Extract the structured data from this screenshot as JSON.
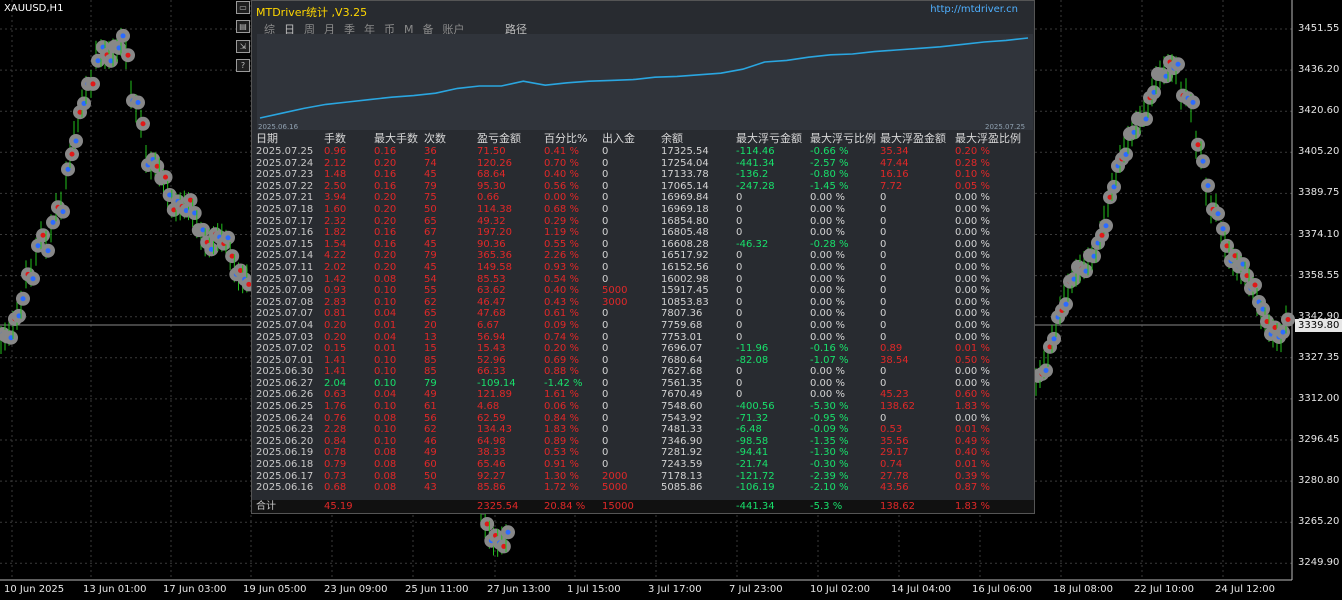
{
  "chart": {
    "symbol": "XAUUSD,H1",
    "current_price": "3339.80",
    "price_labels": [
      "3451.55",
      "3436.20",
      "3420.60",
      "3405.20",
      "3389.75",
      "3374.10",
      "3358.55",
      "3342.90",
      "3327.35",
      "3312.00",
      "3296.45",
      "3280.80",
      "3265.20",
      "3249.90"
    ],
    "time_labels": [
      "10 Jun 2025",
      "13 Jun 01:00",
      "17 Jun 03:00",
      "19 Jun 05:00",
      "23 Jun 09:00",
      "25 Jun 11:00",
      "27 Jun 13:00",
      "1 Jul 15:00",
      "3 Jul 17:00",
      "7 Jul 23:00",
      "10 Jul 02:00",
      "14 Jul 04:00",
      "16 Jul 06:00",
      "18 Jul 08:00",
      "22 Jul 10:00",
      "24 Jul 12:00"
    ]
  },
  "panel": {
    "title": "MTDriver统计 ,V3.25",
    "url": "http://mtdriver.cn",
    "tabs": [
      "综",
      "日",
      "周",
      "月",
      "季",
      "年",
      "币",
      "M",
      "备",
      "账户"
    ],
    "active_tab": "日",
    "extra_tab": "路径",
    "curve_start": "2025.06.16",
    "curve_end": "2025.07.25",
    "curve_values": [
      0,
      0.06,
      0.12,
      0.17,
      0.2,
      0.23,
      0.26,
      0.28,
      0.31,
      0.37,
      0.4,
      0.4,
      0.46,
      0.41,
      0.44,
      0.46,
      0.47,
      0.48,
      0.51,
      0.52,
      0.54,
      0.56,
      0.61,
      0.7,
      0.72,
      0.76,
      0.79,
      0.8,
      0.83,
      0.85,
      0.87,
      0.89,
      0.92,
      0.95,
      0.97,
      1.0
    ]
  },
  "table": {
    "headers": [
      "日期",
      "手数",
      "最大手数",
      "次数",
      "盈亏金额",
      "百分比%",
      "出入金",
      "余额",
      "最大浮亏金额",
      "最大浮亏比例",
      "最大浮盈金额",
      "最大浮盈比例"
    ],
    "rows": [
      {
        "date": "2025.07.25",
        "lots": "0.96",
        "max_lots": "0.16",
        "count": "36",
        "pnl": "71.50",
        "pct": "0.41 %",
        "io": "0",
        "bal": "17325.54",
        "fl": "-114.46",
        "flp": "-0.66 %",
        "fp": "35.34",
        "fpp": "0.20 %",
        "win": true
      },
      {
        "date": "2025.07.24",
        "lots": "2.12",
        "max_lots": "0.20",
        "count": "74",
        "pnl": "120.26",
        "pct": "0.70 %",
        "io": "0",
        "bal": "17254.04",
        "fl": "-441.34",
        "flp": "-2.57 %",
        "fp": "47.44",
        "fpp": "0.28 %",
        "win": true
      },
      {
        "date": "2025.07.23",
        "lots": "1.48",
        "max_lots": "0.16",
        "count": "45",
        "pnl": "68.64",
        "pct": "0.40 %",
        "io": "0",
        "bal": "17133.78",
        "fl": "-136.2",
        "flp": "-0.80 %",
        "fp": "16.16",
        "fpp": "0.10 %",
        "win": true
      },
      {
        "date": "2025.07.22",
        "lots": "2.50",
        "max_lots": "0.16",
        "count": "79",
        "pnl": "95.30",
        "pct": "0.56 %",
        "io": "0",
        "bal": "17065.14",
        "fl": "-247.28",
        "flp": "-1.45 %",
        "fp": "7.72",
        "fpp": "0.05 %",
        "win": true
      },
      {
        "date": "2025.07.21",
        "lots": "3.94",
        "max_lots": "0.20",
        "count": "75",
        "pnl": "0.66",
        "pct": "0.00 %",
        "io": "0",
        "bal": "16969.84",
        "fl": "0",
        "flp": "0.00 %",
        "fp": "0",
        "fpp": "0.00 %",
        "win": true
      },
      {
        "date": "2025.07.18",
        "lots": "1.60",
        "max_lots": "0.20",
        "count": "50",
        "pnl": "114.38",
        "pct": "0.68 %",
        "io": "0",
        "bal": "16969.18",
        "fl": "0",
        "flp": "0.00 %",
        "fp": "0",
        "fpp": "0.00 %",
        "win": true
      },
      {
        "date": "2025.07.17",
        "lots": "2.32",
        "max_lots": "0.20",
        "count": "65",
        "pnl": "49.32",
        "pct": "0.29 %",
        "io": "0",
        "bal": "16854.80",
        "fl": "0",
        "flp": "0.00 %",
        "fp": "0",
        "fpp": "0.00 %",
        "win": true
      },
      {
        "date": "2025.07.16",
        "lots": "1.82",
        "max_lots": "0.16",
        "count": "67",
        "pnl": "197.20",
        "pct": "1.19 %",
        "io": "0",
        "bal": "16805.48",
        "fl": "0",
        "flp": "0.00 %",
        "fp": "0",
        "fpp": "0.00 %",
        "win": true
      },
      {
        "date": "2025.07.15",
        "lots": "1.54",
        "max_lots": "0.16",
        "count": "45",
        "pnl": "90.36",
        "pct": "0.55 %",
        "io": "0",
        "bal": "16608.28",
        "fl": "-46.32",
        "flp": "-0.28 %",
        "fp": "0",
        "fpp": "0.00 %",
        "win": true
      },
      {
        "date": "2025.07.14",
        "lots": "4.22",
        "max_lots": "0.20",
        "count": "79",
        "pnl": "365.36",
        "pct": "2.26 %",
        "io": "0",
        "bal": "16517.92",
        "fl": "0",
        "flp": "0.00 %",
        "fp": "0",
        "fpp": "0.00 %",
        "win": true
      },
      {
        "date": "2025.07.11",
        "lots": "2.02",
        "max_lots": "0.20",
        "count": "45",
        "pnl": "149.58",
        "pct": "0.93 %",
        "io": "0",
        "bal": "16152.56",
        "fl": "0",
        "flp": "0.00 %",
        "fp": "0",
        "fpp": "0.00 %",
        "win": true
      },
      {
        "date": "2025.07.10",
        "lots": "1.42",
        "max_lots": "0.08",
        "count": "54",
        "pnl": "85.53",
        "pct": "0.54 %",
        "io": "0",
        "bal": "16002.98",
        "fl": "0",
        "flp": "0.00 %",
        "fp": "0",
        "fpp": "0.00 %",
        "win": true
      },
      {
        "date": "2025.07.09",
        "lots": "0.93",
        "max_lots": "0.10",
        "count": "55",
        "pnl": "63.62",
        "pct": "0.40 %",
        "io": "5000",
        "bal": "15917.45",
        "fl": "0",
        "flp": "0.00 %",
        "fp": "0",
        "fpp": "0.00 %",
        "win": true
      },
      {
        "date": "2025.07.08",
        "lots": "2.83",
        "max_lots": "0.10",
        "count": "62",
        "pnl": "46.47",
        "pct": "0.43 %",
        "io": "3000",
        "bal": "10853.83",
        "fl": "0",
        "flp": "0.00 %",
        "fp": "0",
        "fpp": "0.00 %",
        "win": true
      },
      {
        "date": "2025.07.07",
        "lots": "0.81",
        "max_lots": "0.04",
        "count": "65",
        "pnl": "47.68",
        "pct": "0.61 %",
        "io": "0",
        "bal": "7807.36",
        "fl": "0",
        "flp": "0.00 %",
        "fp": "0",
        "fpp": "0.00 %",
        "win": true
      },
      {
        "date": "2025.07.04",
        "lots": "0.20",
        "max_lots": "0.01",
        "count": "20",
        "pnl": "6.67",
        "pct": "0.09 %",
        "io": "0",
        "bal": "7759.68",
        "fl": "0",
        "flp": "0.00 %",
        "fp": "0",
        "fpp": "0.00 %",
        "win": true
      },
      {
        "date": "2025.07.03",
        "lots": "0.20",
        "max_lots": "0.04",
        "count": "13",
        "pnl": "56.94",
        "pct": "0.74 %",
        "io": "0",
        "bal": "7753.01",
        "fl": "0",
        "flp": "0.00 %",
        "fp": "0",
        "fpp": "0.00 %",
        "win": true
      },
      {
        "date": "2025.07.02",
        "lots": "0.15",
        "max_lots": "0.01",
        "count": "15",
        "pnl": "15.43",
        "pct": "0.20 %",
        "io": "0",
        "bal": "7696.07",
        "fl": "-11.96",
        "flp": "-0.16 %",
        "fp": "0.89",
        "fpp": "0.01 %",
        "win": true
      },
      {
        "date": "2025.07.01",
        "lots": "1.41",
        "max_lots": "0.10",
        "count": "85",
        "pnl": "52.96",
        "pct": "0.69 %",
        "io": "0",
        "bal": "7680.64",
        "fl": "-82.08",
        "flp": "-1.07 %",
        "fp": "38.54",
        "fpp": "0.50 %",
        "win": true
      },
      {
        "date": "2025.06.30",
        "lots": "1.41",
        "max_lots": "0.10",
        "count": "85",
        "pnl": "66.33",
        "pct": "0.88 %",
        "io": "0",
        "bal": "7627.68",
        "fl": "0",
        "flp": "0.00 %",
        "fp": "0",
        "fpp": "0.00 %",
        "win": true
      },
      {
        "date": "2025.06.27",
        "lots": "2.04",
        "max_lots": "0.10",
        "count": "79",
        "pnl": "-109.14",
        "pct": "-1.42 %",
        "io": "0",
        "bal": "7561.35",
        "fl": "0",
        "flp": "0.00 %",
        "fp": "0",
        "fpp": "0.00 %",
        "win": false
      },
      {
        "date": "2025.06.26",
        "lots": "0.63",
        "max_lots": "0.04",
        "count": "49",
        "pnl": "121.89",
        "pct": "1.61 %",
        "io": "0",
        "bal": "7670.49",
        "fl": "0",
        "flp": "0.00 %",
        "fp": "45.23",
        "fpp": "0.60 %",
        "win": true
      },
      {
        "date": "2025.06.25",
        "lots": "1.76",
        "max_lots": "0.10",
        "count": "61",
        "pnl": "4.68",
        "pct": "0.06 %",
        "io": "0",
        "bal": "7548.60",
        "fl": "-400.56",
        "flp": "-5.30 %",
        "fp": "138.62",
        "fpp": "1.83 %",
        "win": true
      },
      {
        "date": "2025.06.24",
        "lots": "0.76",
        "max_lots": "0.08",
        "count": "56",
        "pnl": "62.59",
        "pct": "0.84 %",
        "io": "0",
        "bal": "7543.92",
        "fl": "-71.32",
        "flp": "-0.95 %",
        "fp": "0",
        "fpp": "0.00 %",
        "win": true
      },
      {
        "date": "2025.06.23",
        "lots": "2.28",
        "max_lots": "0.10",
        "count": "62",
        "pnl": "134.43",
        "pct": "1.83 %",
        "io": "0",
        "bal": "7481.33",
        "fl": "-6.48",
        "flp": "-0.09 %",
        "fp": "0.53",
        "fpp": "0.01 %",
        "win": true
      },
      {
        "date": "2025.06.20",
        "lots": "0.84",
        "max_lots": "0.10",
        "count": "46",
        "pnl": "64.98",
        "pct": "0.89 %",
        "io": "0",
        "bal": "7346.90",
        "fl": "-98.58",
        "flp": "-1.35 %",
        "fp": "35.56",
        "fpp": "0.49 %",
        "win": true
      },
      {
        "date": "2025.06.19",
        "lots": "0.78",
        "max_lots": "0.08",
        "count": "49",
        "pnl": "38.33",
        "pct": "0.53 %",
        "io": "0",
        "bal": "7281.92",
        "fl": "-94.41",
        "flp": "-1.30 %",
        "fp": "29.17",
        "fpp": "0.40 %",
        "win": true
      },
      {
        "date": "2025.06.18",
        "lots": "0.79",
        "max_lots": "0.08",
        "count": "60",
        "pnl": "65.46",
        "pct": "0.91 %",
        "io": "0",
        "bal": "7243.59",
        "fl": "-21.74",
        "flp": "-0.30 %",
        "fp": "0.74",
        "fpp": "0.01 %",
        "win": true
      },
      {
        "date": "2025.06.17",
        "lots": "0.73",
        "max_lots": "0.08",
        "count": "50",
        "pnl": "92.27",
        "pct": "1.30 %",
        "io": "2000",
        "bal": "7178.13",
        "fl": "-121.72",
        "flp": "-2.39 %",
        "fp": "27.78",
        "fpp": "0.39 %",
        "win": true
      },
      {
        "date": "2025.06.16",
        "lots": "0.68",
        "max_lots": "0.08",
        "count": "43",
        "pnl": "85.86",
        "pct": "1.72 %",
        "io": "5000",
        "bal": "5085.86",
        "fl": "-106.19",
        "flp": "-2.10 %",
        "fp": "43.56",
        "fpp": "0.87 %",
        "win": true
      }
    ],
    "total": {
      "label": "合计",
      "lots": "45.19",
      "pnl": "2325.54",
      "pct": "20.84 %",
      "io": "15000",
      "fl": "-441.34",
      "flp": "-5.3 %",
      "fp": "138.62",
      "fpp": "1.83 %"
    }
  }
}
